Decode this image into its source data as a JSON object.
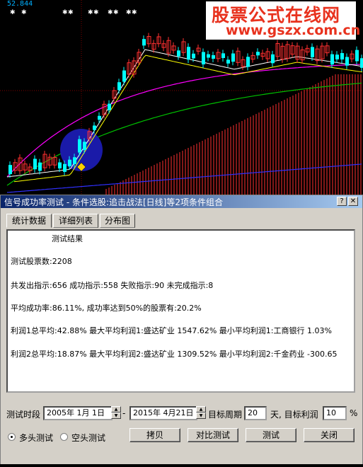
{
  "chart": {
    "readout": "52.844",
    "watermark_title": "股票公式在线网",
    "watermark_url": "www.gszx.com.cn",
    "colors": {
      "up": "#ff3030",
      "down": "#00ffff",
      "ma_white": "#ffffff",
      "ma_yellow": "#ffff00",
      "ma_magenta": "#ff00ff",
      "ma_green": "#00c000",
      "hist": "#ff3030",
      "blue": "#3030ff",
      "circle": "#1a1aa8"
    }
  },
  "dialog": {
    "title": "信号成功率测试 - 条件选股:追击战法[日线]等2项条件组合",
    "tabs": [
      {
        "label": "统计数据"
      },
      {
        "label": "详细列表"
      },
      {
        "label": "分布图"
      }
    ],
    "results": {
      "heading": "测试结果",
      "line1": "测试股票数:2208",
      "line2": "共发出指示:656 成功指示:558 失败指示:90 未完成指示:8",
      "line3": "平均成功率:86.11%, 成功率达到50%的股票有:20.2%",
      "line4": "利润1总平均:42.88% 最大平均利润1:盛达矿业 1547.62% 最小平均利润1:工商银行 1.03%",
      "line5": "利润2总平均:18.87% 最大平均利润2:盛达矿业 1309.52% 最小平均利润2:千金药业 -300.65"
    },
    "period_label": "测试时段",
    "start_date": "2005年 1月 1日",
    "dash": "-",
    "end_date": "2015年 4月21日",
    "target_period_label": "目标周期",
    "target_period_value": "20",
    "target_profit_label": "天, 目标利润",
    "target_profit_value": "10",
    "percent": "%",
    "radio_long": "多头测试",
    "radio_short": "空头测试",
    "buttons": {
      "copy": "拷贝",
      "compare": "对比测试",
      "test": "测试",
      "close": "关闭"
    }
  }
}
